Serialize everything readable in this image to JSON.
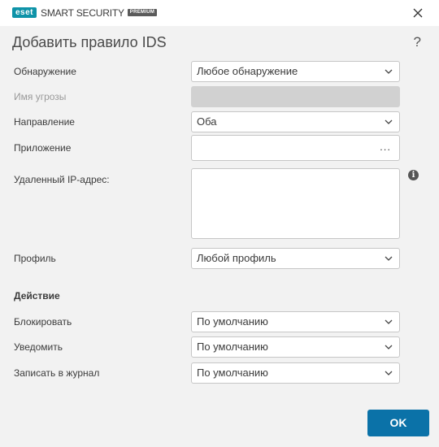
{
  "app": {
    "brand": "eset",
    "product": "SMART SECURITY",
    "edition": "PREMIUM"
  },
  "dialog": {
    "title": "Добавить правило IDS",
    "help": "?"
  },
  "form": {
    "detection": {
      "label": "Обнаружение",
      "value": "Любое обнаружение"
    },
    "threat_name": {
      "label": "Имя угрозы"
    },
    "direction": {
      "label": "Направление",
      "value": "Оба"
    },
    "application": {
      "label": "Приложение",
      "browse": "..."
    },
    "remote_ip": {
      "label": "Удаленный IP-адрес:"
    },
    "profile": {
      "label": "Профиль",
      "value": "Любой профиль"
    }
  },
  "action": {
    "heading": "Действие",
    "block": {
      "label": "Блокировать",
      "value": "По умолчанию"
    },
    "notify": {
      "label": "Уведомить",
      "value": "По умолчанию"
    },
    "log": {
      "label": "Записать в журнал",
      "value": "По умолчанию"
    }
  },
  "buttons": {
    "ok": "OK"
  },
  "colors": {
    "accent": "#0b72a8",
    "brand": "#0e93a8",
    "background": "#f2f2f2"
  }
}
